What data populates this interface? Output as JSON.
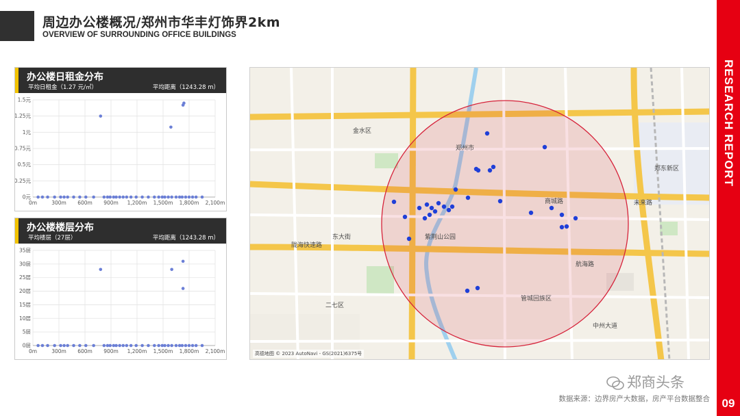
{
  "header": {
    "title": "周边办公楼概况/郑州市华丰灯饰界2km",
    "subtitle": "OVERVIEW OF SURROUNDING OFFICE BUILDINGS"
  },
  "sidebar": {
    "label": "RESEARCH REPORT",
    "page_number": "09",
    "color": "#e60012"
  },
  "rent_panel": {
    "title": "办公楼日租金分布",
    "avg_label": "平均日租金（1.27 元/㎡）",
    "distance_label": "平均距离（1243.28 m）"
  },
  "floor_panel": {
    "title": "办公楼楼层分布",
    "avg_label": "平均楼层（27层）",
    "distance_label": "平均距离（1243.28 m）"
  },
  "chart_data": [
    {
      "type": "scatter",
      "title": "办公楼日租金分布",
      "x_ticks": [
        "0m",
        "300m",
        "600m",
        "900m",
        "1,200m",
        "1,500m",
        "1,800m",
        "2,100m"
      ],
      "y_ticks": [
        "0元",
        "0.25元",
        "0.5元",
        "0.75元",
        "1元",
        "1.25元",
        "1.5元"
      ],
      "xlim": [
        0,
        2100
      ],
      "ylim": [
        0,
        1.5
      ],
      "points": [
        [
          780,
          1.25
        ],
        [
          1590,
          1.08
        ],
        [
          1730,
          1.42
        ],
        [
          1740,
          1.45
        ],
        [
          60,
          0
        ],
        [
          110,
          0
        ],
        [
          170,
          0
        ],
        [
          250,
          0
        ],
        [
          320,
          0
        ],
        [
          360,
          0
        ],
        [
          400,
          0
        ],
        [
          470,
          0
        ],
        [
          540,
          0
        ],
        [
          610,
          0
        ],
        [
          700,
          0
        ],
        [
          820,
          0
        ],
        [
          860,
          0
        ],
        [
          890,
          0
        ],
        [
          930,
          0
        ],
        [
          960,
          0
        ],
        [
          1000,
          0
        ],
        [
          1040,
          0
        ],
        [
          1080,
          0
        ],
        [
          1130,
          0
        ],
        [
          1190,
          0
        ],
        [
          1260,
          0
        ],
        [
          1330,
          0
        ],
        [
          1400,
          0
        ],
        [
          1450,
          0
        ],
        [
          1490,
          0
        ],
        [
          1520,
          0
        ],
        [
          1560,
          0
        ],
        [
          1600,
          0
        ],
        [
          1650,
          0
        ],
        [
          1690,
          0
        ],
        [
          1720,
          0
        ],
        [
          1760,
          0
        ],
        [
          1800,
          0
        ],
        [
          1840,
          0
        ],
        [
          1880,
          0
        ],
        [
          1950,
          0
        ]
      ]
    },
    {
      "type": "scatter",
      "title": "办公楼楼层分布",
      "x_ticks": [
        "0m",
        "300m",
        "600m",
        "900m",
        "1,200m",
        "1,500m",
        "1,800m",
        "2,100m"
      ],
      "y_ticks": [
        "0层",
        "5层",
        "10层",
        "15层",
        "20层",
        "25层",
        "30层",
        "35层"
      ],
      "xlim": [
        0,
        2100
      ],
      "ylim": [
        0,
        35
      ],
      "points": [
        [
          780,
          28
        ],
        [
          1600,
          28
        ],
        [
          1730,
          31
        ],
        [
          1730,
          21
        ],
        [
          60,
          0
        ],
        [
          110,
          0
        ],
        [
          170,
          0
        ],
        [
          250,
          0
        ],
        [
          320,
          0
        ],
        [
          360,
          0
        ],
        [
          400,
          0
        ],
        [
          470,
          0
        ],
        [
          540,
          0
        ],
        [
          610,
          0
        ],
        [
          700,
          0
        ],
        [
          820,
          0
        ],
        [
          860,
          0
        ],
        [
          890,
          0
        ],
        [
          930,
          0
        ],
        [
          960,
          0
        ],
        [
          1000,
          0
        ],
        [
          1040,
          0
        ],
        [
          1080,
          0
        ],
        [
          1130,
          0
        ],
        [
          1190,
          0
        ],
        [
          1260,
          0
        ],
        [
          1330,
          0
        ],
        [
          1400,
          0
        ],
        [
          1450,
          0
        ],
        [
          1490,
          0
        ],
        [
          1520,
          0
        ],
        [
          1560,
          0
        ],
        [
          1600,
          0
        ],
        [
          1650,
          0
        ],
        [
          1690,
          0
        ],
        [
          1720,
          0
        ],
        [
          1760,
          0
        ],
        [
          1800,
          0
        ],
        [
          1840,
          0
        ],
        [
          1880,
          0
        ],
        [
          1950,
          0
        ]
      ]
    }
  ],
  "map": {
    "labels": [
      "郑州市",
      "紫荆山公园",
      "商城路",
      "东大街",
      "未来路",
      "航海路",
      "郑东新区",
      "管城回族区",
      "二七区",
      "陇海快速路",
      "金水区",
      "中州大道"
    ],
    "copyright": "高德地图 © 2023 AutoNavi - GS(2021)6375号",
    "circle_color": "#d6223a",
    "marker_color": "#1f3fd8"
  },
  "footer": {
    "watermark": "郑商头条",
    "source": "数据来源：边界房产大数据，房产平台数据整合"
  }
}
